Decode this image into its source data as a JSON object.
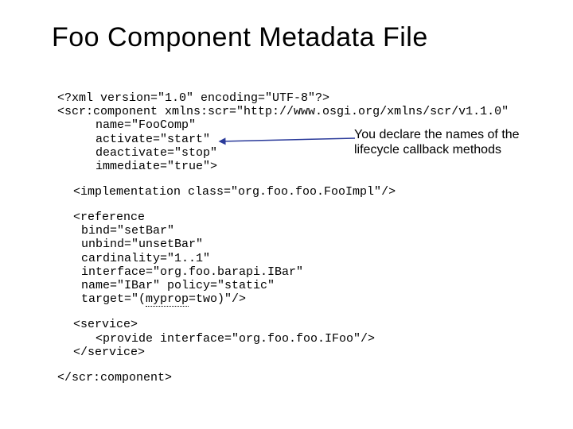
{
  "title": "Foo Component Metadata File",
  "code": {
    "l1": "<?xml version=\"1.0\" encoding=\"UTF-8\"?>",
    "l2": "<scr:component xmlns:scr=\"http://www.osgi.org/xmlns/scr/v1.1.0\"",
    "l3": "name=\"FooComp\"",
    "l4": "activate=\"start\"",
    "l5": "deactivate=\"stop\"",
    "l6": "immediate=\"true\">",
    "l7": "<implementation class=\"org.foo.foo.FooImpl\"/>",
    "l8": "<reference",
    "l9": "bind=\"setBar\"",
    "l10": "unbind=\"unsetBar\"",
    "l11": "cardinality=\"1..1\"",
    "l12": "interface=\"org.foo.barapi.IBar\"",
    "l13": "name=\"IBar\" policy=\"static\"",
    "l14_pre": "target=\"(",
    "l14_u": "myprop",
    "l14_post": "=two)\"/>",
    "l15": "<service>",
    "l16": "<provide interface=\"org.foo.foo.IFoo\"/>",
    "l17": "</service>",
    "l18": "</scr:component>"
  },
  "annotation": "You declare the names of the lifecycle callback methods"
}
